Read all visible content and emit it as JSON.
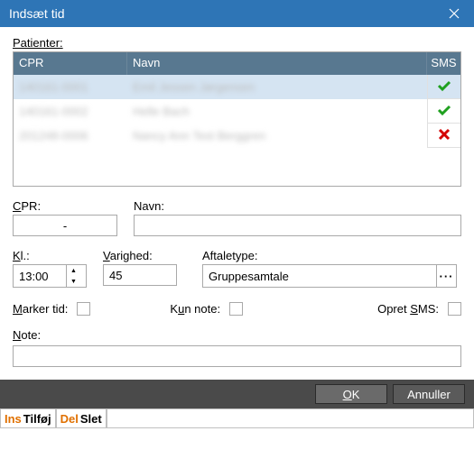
{
  "title": "Indsæt tid",
  "labels": {
    "patienter": "Patienter:",
    "cpr_col": "CPR",
    "navn_col": "Navn",
    "sms_col": "SMS",
    "cpr": "CPR:",
    "cpr_u": "C",
    "navn": "Navn:",
    "kl": "Kl.:",
    "kl_u": "K",
    "varighed": "Varighed:",
    "varighed_u": "V",
    "aftaletype": "Aftaletype:",
    "marker": "Marker tid:",
    "marker_u": "M",
    "kun_note": "Kun note:",
    "kun_note_u": "u",
    "opret_sms": "Opret SMS:",
    "opret_sms_u": "S",
    "note": "Note:",
    "note_u": "N",
    "ok": "OK",
    "ok_u": "O",
    "annuller": "Annuller"
  },
  "patients": [
    {
      "cpr": "140161-0001",
      "navn": "Emil Jessen Jørgensen",
      "sms": true
    },
    {
      "cpr": "140161-0002",
      "navn": "Helle Bach",
      "sms": true
    },
    {
      "cpr": "201248-0006",
      "navn": "Nancy Ann Test Berggren",
      "sms": false
    }
  ],
  "fields": {
    "cpr": "-",
    "navn": "",
    "kl": "13:00",
    "varighed": "45",
    "aftaletype": "Gruppesamtale",
    "note": ""
  },
  "status": {
    "k1": "Ins",
    "t1": "Tilføj",
    "k2": "Del",
    "t2": "Slet"
  }
}
